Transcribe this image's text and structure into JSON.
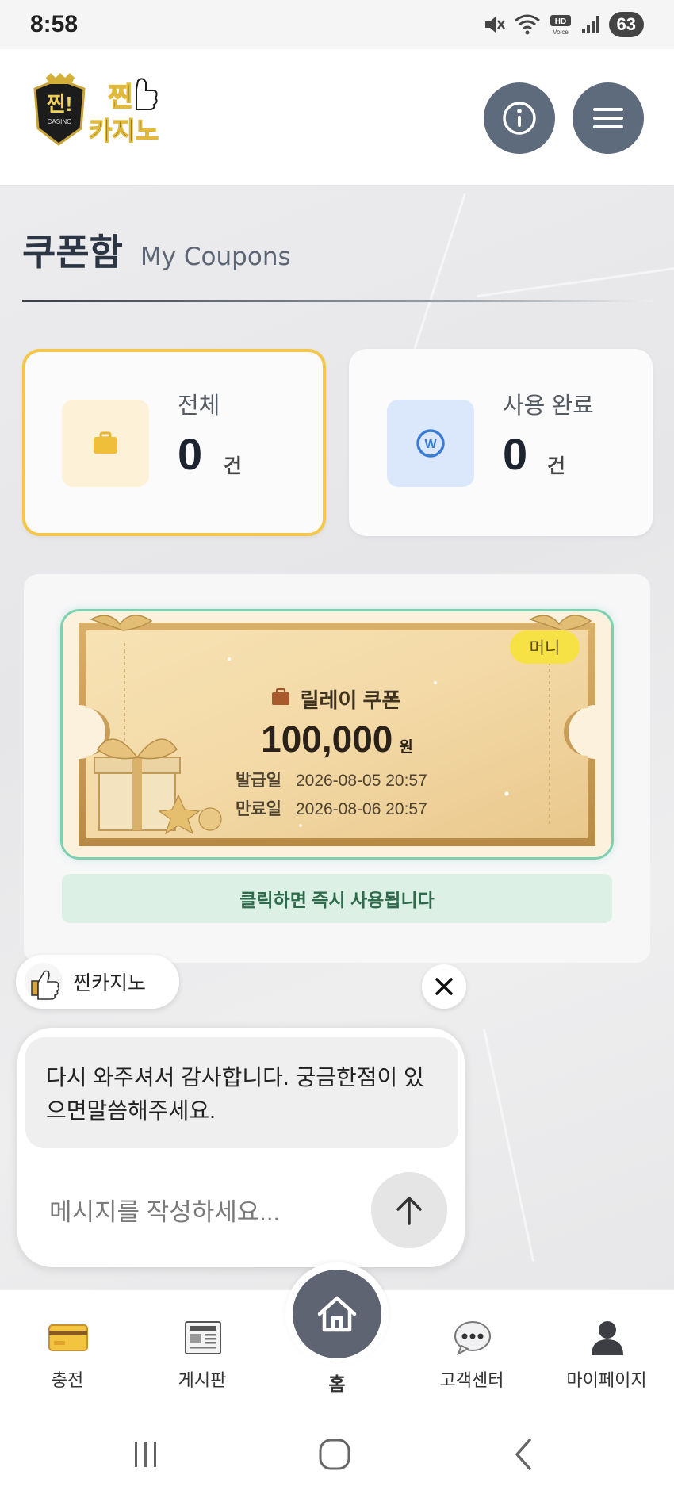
{
  "status_bar": {
    "time": "8:58",
    "battery": "63",
    "icons": [
      "mute-icon",
      "wifi-icon",
      "hd-voice-icon",
      "signal-icon"
    ]
  },
  "header": {
    "logo": {
      "badge_text": "찐!",
      "badge_sub": "CASINO",
      "wordmark_line1": "찐",
      "wordmark_line2": "카지노"
    },
    "info_icon": "info-icon",
    "menu_icon": "hamburger-menu-icon"
  },
  "page": {
    "title": "쿠폰함",
    "subtitle": "My Coupons"
  },
  "stats": [
    {
      "label": "전체",
      "value": "0",
      "unit": "건",
      "icon": "briefcase-icon",
      "accent": "#f4c74a"
    },
    {
      "label": "사용 완료",
      "value": "0",
      "unit": "건",
      "icon": "won-coin-icon",
      "accent": "#3a7bd5"
    }
  ],
  "coupon": {
    "badge": "머니",
    "name": "릴레이 쿠폰",
    "amount": "100,000",
    "currency": "원",
    "issued_label": "발급일",
    "issued": "2026-08-05 20:57",
    "expires_label": "만료일",
    "expires": "2026-08-06 20:57",
    "use_note": "클릭하면 즉시 사용됩니다"
  },
  "chat": {
    "agent_name": "찐카지노",
    "message": "다시 와주셔서 감사합니다. 궁금한점이 있으면말씀해주세요.",
    "input_placeholder": "메시지를 작성하세요...",
    "input_value": ""
  },
  "bottom_nav": {
    "items": [
      {
        "label": "충전",
        "icon": "credit-card-icon"
      },
      {
        "label": "게시판",
        "icon": "newspaper-icon"
      },
      {
        "label": "홈",
        "icon": "home-icon"
      },
      {
        "label": "고객센터",
        "icon": "chat-bubble-icon"
      },
      {
        "label": "마이페이지",
        "icon": "user-icon"
      }
    ]
  },
  "colors": {
    "accent_yellow": "#f4c74a",
    "header_button": "#5e6b7d",
    "ticket_border": "#7fd0b0",
    "note_green": "#2d6b4b"
  }
}
